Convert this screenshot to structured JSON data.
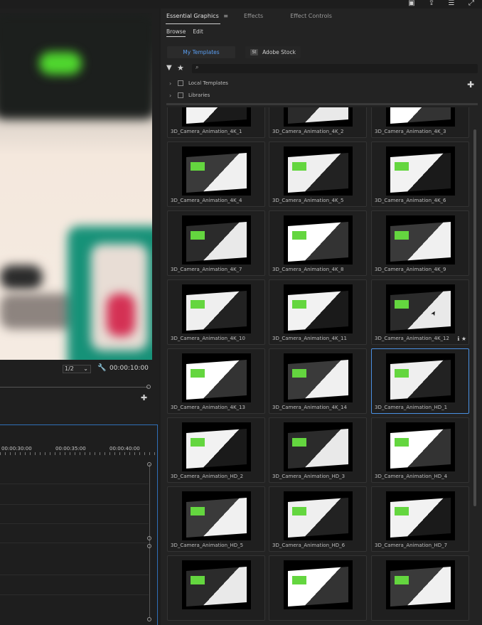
{
  "window_icons": [
    "layout-icon",
    "share-icon",
    "settings-icon",
    "expand-icon"
  ],
  "program_monitor": {
    "resolution": "1/2",
    "timecode": "00:00:10:00"
  },
  "timeline": {
    "ruler_labels": [
      "00:00:30:00",
      "00:00:35:00",
      "00:00:40:00"
    ]
  },
  "panel": {
    "tabs": [
      {
        "label": "Essential Graphics",
        "active": true
      },
      {
        "label": "Effects",
        "active": false
      },
      {
        "label": "Effect Controls",
        "active": false
      }
    ],
    "menu_glyph": "≡",
    "subtabs": [
      {
        "label": "Browse",
        "active": true
      },
      {
        "label": "Edit",
        "active": false
      }
    ],
    "sources": {
      "my_templates": "My Templates",
      "stock_badge": "St",
      "adobe_stock": "Adobe Stock"
    },
    "search_placeholder": "",
    "tree": [
      {
        "label": "Local Templates"
      },
      {
        "label": "Libraries"
      }
    ],
    "templates": [
      "3D_Camera_Animation_4K_1",
      "3D_Camera_Animation_4K_2",
      "3D_Camera_Animation_4K_3",
      "3D_Camera_Animation_4K_4",
      "3D_Camera_Animation_4K_5",
      "3D_Camera_Animation_4K_6",
      "3D_Camera_Animation_4K_7",
      "3D_Camera_Animation_4K_8",
      "3D_Camera_Animation_4K_9",
      "3D_Camera_Animation_4K_10",
      "3D_Camera_Animation_4K_11",
      "3D_Camera_Animation_4K_12",
      "3D_Camera_Animation_4K_13",
      "3D_Camera_Animation_4K_14",
      "3D_Camera_Animation_HD_1",
      "3D_Camera_Animation_HD_2",
      "3D_Camera_Animation_HD_3",
      "3D_Camera_Animation_HD_4",
      "3D_Camera_Animation_HD_5",
      "3D_Camera_Animation_HD_6",
      "3D_Camera_Animation_HD_7",
      "",
      "",
      ""
    ],
    "selected_template": "3D_Camera_Animation_HD_1",
    "hovered_template_icons": "ℹ ★",
    "accent_color": "#4a90e2"
  }
}
